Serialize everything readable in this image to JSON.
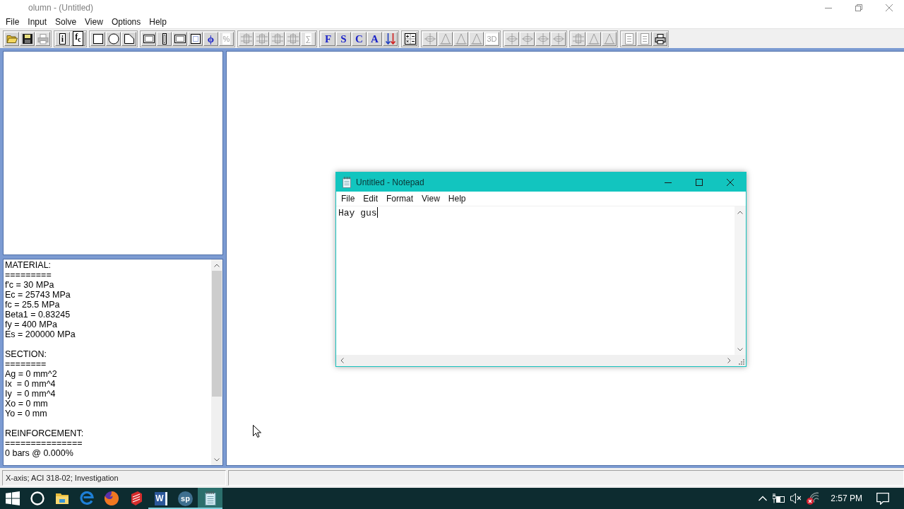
{
  "app": {
    "title": "olumn - (Untitled)",
    "controls": [
      {
        "kind": "minimize"
      },
      {
        "kind": "restore"
      },
      {
        "kind": "close"
      }
    ]
  },
  "menu": [
    "File",
    "Input",
    "Solve",
    "View",
    "Options",
    "Help"
  ],
  "toolbar": [
    [
      {
        "kind": "open",
        "disabled": false
      },
      {
        "kind": "save",
        "disabled": false
      },
      {
        "kind": "print",
        "disabled": true
      }
    ],
    [
      {
        "kind": "boxed-letter",
        "label": "i",
        "disabled": false
      },
      {
        "kind": "boxed-letter",
        "label": "f$_{c}$",
        "disabled": false
      }
    ],
    [
      {
        "kind": "square",
        "disabled": false
      },
      {
        "kind": "circle",
        "disabled": false
      },
      {
        "kind": "polygon",
        "disabled": false
      }
    ],
    [
      {
        "kind": "dotted-wide",
        "disabled": false
      },
      {
        "kind": "dotted-narrow",
        "disabled": false
      },
      {
        "kind": "dotted-wide",
        "disabled": false
      },
      {
        "kind": "dotted-square",
        "disabled": false
      },
      {
        "kind": "letter",
        "label": "ϕ",
        "disabled": false
      },
      {
        "kind": "label",
        "label": "%",
        "disabled": true
      }
    ],
    [
      {
        "kind": "grid",
        "disabled": true
      },
      {
        "kind": "grid",
        "disabled": true
      },
      {
        "kind": "grid",
        "disabled": true
      },
      {
        "kind": "grid",
        "disabled": true
      },
      {
        "kind": "label",
        "label": "∑",
        "disabled": true
      }
    ],
    [
      {
        "kind": "letter",
        "label": "F",
        "disabled": false
      },
      {
        "kind": "letter",
        "label": "S",
        "disabled": false
      },
      {
        "kind": "letter",
        "label": "C",
        "disabled": false
      },
      {
        "kind": "letter",
        "label": "A",
        "disabled": false
      },
      {
        "kind": "sort",
        "disabled": false
      }
    ],
    [
      {
        "kind": "calc",
        "disabled": false
      }
    ],
    [
      {
        "kind": "axes",
        "disabled": true
      },
      {
        "kind": "diagram",
        "disabled": true
      },
      {
        "kind": "diagram",
        "disabled": true
      },
      {
        "kind": "diagram",
        "disabled": true
      },
      {
        "kind": "label",
        "label": "3D",
        "disabled": true
      }
    ],
    [
      {
        "kind": "axes",
        "disabled": true
      },
      {
        "kind": "axes",
        "disabled": true
      },
      {
        "kind": "axes",
        "disabled": true
      },
      {
        "kind": "axes",
        "disabled": true
      }
    ],
    [
      {
        "kind": "grid",
        "disabled": true
      },
      {
        "kind": "diagram",
        "disabled": true
      },
      {
        "kind": "diagram",
        "disabled": true
      }
    ],
    [
      {
        "kind": "document",
        "disabled": true
      },
      {
        "kind": "document",
        "disabled": true
      },
      {
        "kind": "print",
        "disabled": false
      }
    ]
  ],
  "results": {
    "sections": [
      {
        "heading": "MATERIAL:",
        "rule": "=========",
        "lines": [
          "f'c = 30 MPa",
          "Ec = 25743 MPa",
          "fc = 25.5 MPa",
          "Beta1 = 0.83245",
          "fy = 400 MPa",
          "Es = 200000 MPa"
        ]
      },
      {
        "heading": "SECTION:",
        "rule": "========",
        "lines": [
          "Ag = 0 mm^2",
          "Ix  = 0 mm^4",
          "Iy  = 0 mm^4",
          "Xo = 0 mm",
          "Yo = 0 mm"
        ]
      },
      {
        "heading": "REINFORCEMENT:",
        "rule": "===============",
        "lines": [
          "0 bars @ 0.000%"
        ]
      }
    ]
  },
  "status_bar": [
    "X-axis; ACI 318-02; Investigation"
  ],
  "notepad": {
    "title": "Untitled - Notepad",
    "controls": [
      {
        "kind": "minimize"
      },
      {
        "kind": "maximize"
      },
      {
        "kind": "close"
      }
    ],
    "menu": [
      "File",
      "Edit",
      "Format",
      "View",
      "Help"
    ],
    "text": "Hay gus"
  },
  "taskbar": {
    "items": [
      {
        "kind": "start",
        "running": false,
        "selected": false
      },
      {
        "kind": "ring",
        "running": false,
        "selected": false
      },
      {
        "kind": "folder",
        "running": false,
        "selected": false
      },
      {
        "kind": "browser",
        "running": false,
        "selected": false
      },
      {
        "kind": "globe",
        "running": false,
        "selected": false
      },
      {
        "kind": "cube",
        "running": false,
        "selected": false
      },
      {
        "kind": "tile",
        "label": "W",
        "running": true,
        "selected": false
      },
      {
        "kind": "badge",
        "label": "sp",
        "running": true,
        "selected": false
      },
      {
        "kind": "notepad",
        "running": true,
        "selected": true
      }
    ],
    "tray": [
      {
        "kind": "chevron"
      },
      {
        "kind": "power"
      },
      {
        "kind": "volume-muted"
      },
      {
        "kind": "wifi-off"
      }
    ],
    "clock": "2:57 PM",
    "notifications": {
      "kind": "bubble"
    }
  }
}
